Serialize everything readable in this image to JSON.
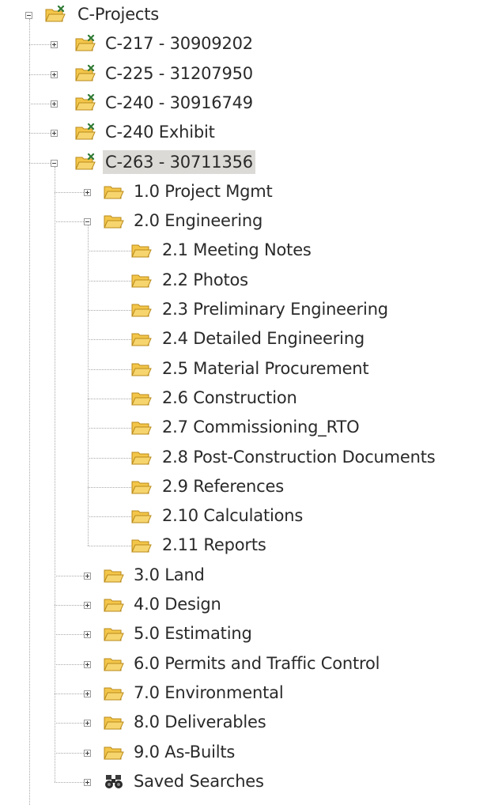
{
  "tree": {
    "root": {
      "label": "C-Projects",
      "icon": "project-folder-icon",
      "expanded": true
    },
    "projects": [
      {
        "label": "C-217 - 30909202",
        "icon": "project-folder-icon",
        "expanded": false
      },
      {
        "label": "C-225 - 31207950",
        "icon": "project-folder-icon",
        "expanded": false
      },
      {
        "label": "C-240 - 30916749",
        "icon": "project-folder-icon",
        "expanded": false
      },
      {
        "label": "C-240 Exhibit",
        "icon": "project-folder-icon",
        "expanded": false
      },
      {
        "label": "C-263 - 30711356",
        "icon": "project-folder-icon",
        "expanded": true,
        "selected": true
      }
    ],
    "sections": [
      {
        "label": "1.0 Project Mgmt",
        "icon": "folder-icon",
        "expanded": false
      },
      {
        "label": "2.0 Engineering",
        "icon": "folder-icon",
        "expanded": true,
        "children": [
          "2.1 Meeting Notes",
          "2.2 Photos",
          "2.3 Preliminary Engineering",
          "2.4 Detailed Engineering",
          "2.5 Material Procurement",
          "2.6 Construction",
          "2.7 Commissioning_RTO",
          "2.8 Post-Construction Documents",
          "2.9 References",
          "2.10 Calculations",
          "2.11 Reports"
        ]
      },
      {
        "label": "3.0 Land",
        "icon": "folder-icon",
        "expanded": false
      },
      {
        "label": "4.0 Design",
        "icon": "folder-icon",
        "expanded": false
      },
      {
        "label": "5.0 Estimating",
        "icon": "folder-icon",
        "expanded": false
      },
      {
        "label": "6.0 Permits and Traffic Control",
        "icon": "folder-icon",
        "expanded": false
      },
      {
        "label": "7.0 Environmental",
        "icon": "folder-icon",
        "expanded": false
      },
      {
        "label": "8.0 Deliverables",
        "icon": "folder-icon",
        "expanded": false
      },
      {
        "label": "9.0 As-Builts",
        "icon": "folder-icon",
        "expanded": false
      },
      {
        "label": "Saved Searches",
        "icon": "binoculars-icon",
        "expanded": false
      }
    ],
    "colors": {
      "folder_fill": "#f3c64a",
      "folder_edge": "#b98a1a",
      "selection_bg": "#dcdad6",
      "project_badge": "#2f7a35"
    }
  }
}
